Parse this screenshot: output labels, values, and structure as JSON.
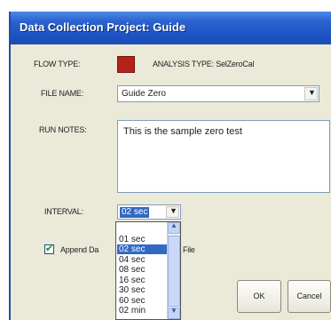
{
  "window": {
    "title": "Data Collection Project: Guide"
  },
  "flow": {
    "label": "FLOW TYPE:",
    "swatch_color": "#b4231b"
  },
  "analysis": {
    "label": "ANALYSIS TYPE: SelZeroCal"
  },
  "file": {
    "label": "FILE NAME:",
    "value": "Guide Zero"
  },
  "notes": {
    "label": "RUN NOTES:",
    "value": "This is the sample zero test"
  },
  "interval": {
    "label": "INTERVAL:",
    "value": "02 sec",
    "options": [
      "01 sec",
      "02 sec",
      "04 sec",
      "08 sec",
      "16 sec",
      "30 sec",
      "60 sec",
      "02 min"
    ],
    "selected_index": 1
  },
  "append": {
    "label_left": "Append Da",
    "label_right": "File",
    "checked": true
  },
  "buttons": {
    "ok": "OK",
    "cancel": "Cancel"
  },
  "colors": {
    "title_bar": "#2a63d0",
    "dialog_bg": "#ebe9d8",
    "selection": "#316ac5"
  },
  "icons": {
    "dropdown": "chevron-down-icon",
    "scroll_up": "chevron-up-icon",
    "scroll_down": "chevron-down-icon",
    "check": "check-icon"
  }
}
